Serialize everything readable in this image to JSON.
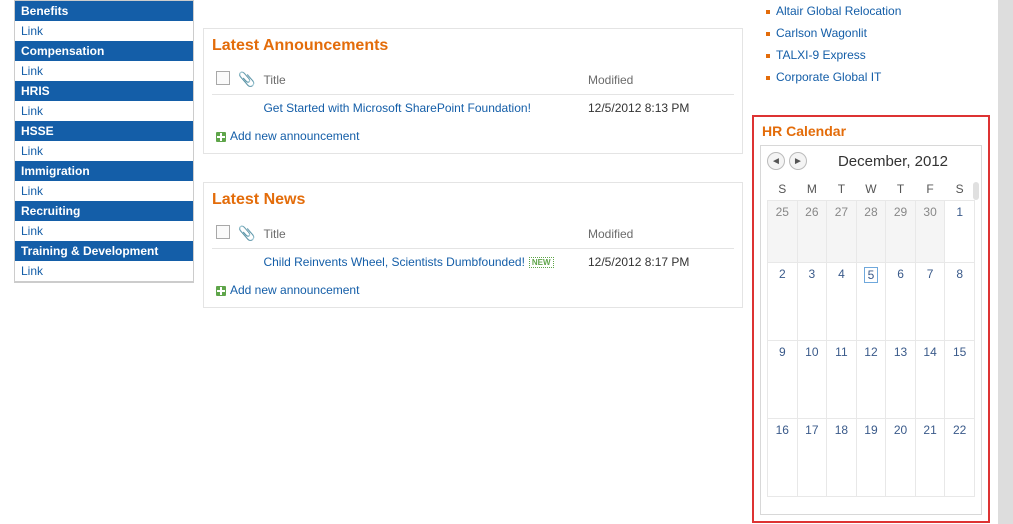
{
  "sidebar": {
    "groups": [
      {
        "header": "Benefits",
        "link": "Link"
      },
      {
        "header": "Compensation",
        "link": "Link"
      },
      {
        "header": "HRIS",
        "link": "Link"
      },
      {
        "header": "HSSE",
        "link": "Link"
      },
      {
        "header": "Immigration",
        "link": "Link"
      },
      {
        "header": "Recruiting",
        "link": "Link"
      },
      {
        "header": "Training & Development",
        "link": "Link"
      }
    ]
  },
  "announcements": {
    "title": "Latest Announcements",
    "col_title": "Title",
    "col_modified": "Modified",
    "rows": [
      {
        "title": "Get Started with Microsoft SharePoint Foundation!",
        "modified": "12/5/2012 8:13 PM",
        "isnew": false
      }
    ],
    "add": "Add new announcement"
  },
  "news": {
    "title": "Latest News",
    "col_title": "Title",
    "col_modified": "Modified",
    "rows": [
      {
        "title": "Child Reinvents Wheel, Scientists Dumbfounded!",
        "modified": "12/5/2012 8:17 PM",
        "isnew": true
      }
    ],
    "add": "Add new announcement",
    "newlabel": "NEW"
  },
  "rightlinks": [
    "Altair Global Relocation",
    "Carlson Wagonlit",
    "TALXI-9 Express",
    "Corporate Global IT"
  ],
  "calendar": {
    "title": "HR Calendar",
    "month": "December, 2012",
    "dows": [
      "S",
      "M",
      "T",
      "W",
      "T",
      "F",
      "S"
    ],
    "weeks": [
      [
        {
          "d": "25",
          "o": true
        },
        {
          "d": "26",
          "o": true
        },
        {
          "d": "27",
          "o": true
        },
        {
          "d": "28",
          "o": true
        },
        {
          "d": "29",
          "o": true
        },
        {
          "d": "30",
          "o": true
        },
        {
          "d": "1"
        }
      ],
      [
        {
          "d": "2"
        },
        {
          "d": "3"
        },
        {
          "d": "4"
        },
        {
          "d": "5",
          "today": true
        },
        {
          "d": "6"
        },
        {
          "d": "7"
        },
        {
          "d": "8"
        }
      ],
      [
        {
          "d": "9"
        },
        {
          "d": "10"
        },
        {
          "d": "11"
        },
        {
          "d": "12"
        },
        {
          "d": "13"
        },
        {
          "d": "14"
        },
        {
          "d": "15"
        }
      ],
      [
        {
          "d": "16"
        },
        {
          "d": "17"
        },
        {
          "d": "18"
        },
        {
          "d": "19"
        },
        {
          "d": "20"
        },
        {
          "d": "21"
        },
        {
          "d": "22"
        }
      ]
    ]
  }
}
